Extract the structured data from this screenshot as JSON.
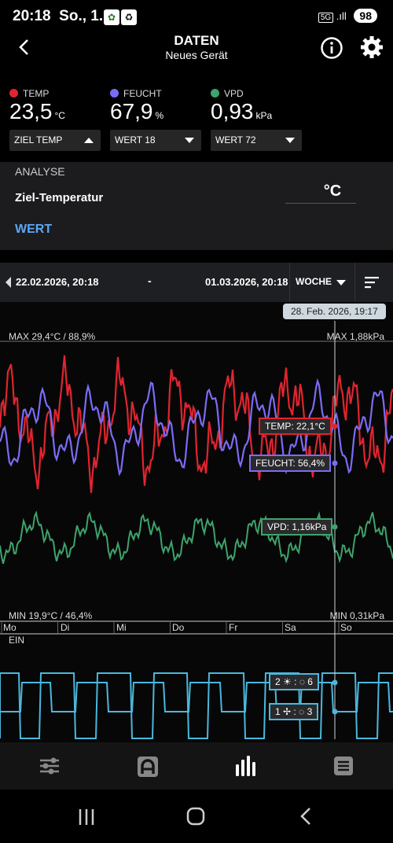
{
  "status": {
    "time": "20:18",
    "date": "So., 1.",
    "network": "5G",
    "battery": "98"
  },
  "header": {
    "title": "DATEN",
    "subtitle": "Neues Gerät"
  },
  "sensors": [
    {
      "label": "TEMP",
      "value": "23,5",
      "unit": "°C",
      "color": "#e0252f",
      "dropdown": "ZIEL TEMP",
      "dropdown_icon": "caret-up"
    },
    {
      "label": "FEUCHT",
      "value": "67,9",
      "unit": "%",
      "color": "#7b6cf6",
      "dropdown": "WERT 18",
      "dropdown_icon": "caret-down"
    },
    {
      "label": "VPD",
      "value": "0,93",
      "unit": "kPa",
      "color": "#3ea46b",
      "dropdown": "WERT 72",
      "dropdown_icon": "caret-down"
    }
  ],
  "analyse": {
    "section_label": "ANALYSE",
    "target_label": "Ziel-Temperatur",
    "unit": "°C",
    "value_button": "WERT"
  },
  "range": {
    "from": "22.02.2026, 20:18",
    "separator": "-",
    "to": "01.03.2026, 20:18",
    "period": "WOCHE"
  },
  "chart": {
    "cursor_time": "28. Feb. 2026, 19:17",
    "max_left": "MAX 29,4°C / 88,9%",
    "max_right": "MAX 1,88kPa",
    "min_left": "MIN 19,9°C / 46,4%",
    "min_right": "MIN 0,31kPa",
    "days": [
      "Mo",
      "Di",
      "Mi",
      "Do",
      "Fr",
      "Sa",
      "So"
    ],
    "tooltip_temp": "TEMP: 22,1°C",
    "tooltip_feucht": "FEUCHT: 56,4%",
    "tooltip_vpd": "VPD: 1,16kPa",
    "on_label": "EIN",
    "device1_prefix": "2",
    "device1_value": "6",
    "device2_prefix": "1",
    "device2_value": "3",
    "colors": {
      "temp": "#e0252f",
      "feucht": "#7b6cf6",
      "vpd": "#3ea46b",
      "device": "#4bb8dd"
    }
  },
  "nav": {
    "items": [
      "sliders-icon",
      "mode-a-icon",
      "bar-chart-icon",
      "list-icon"
    ]
  }
}
